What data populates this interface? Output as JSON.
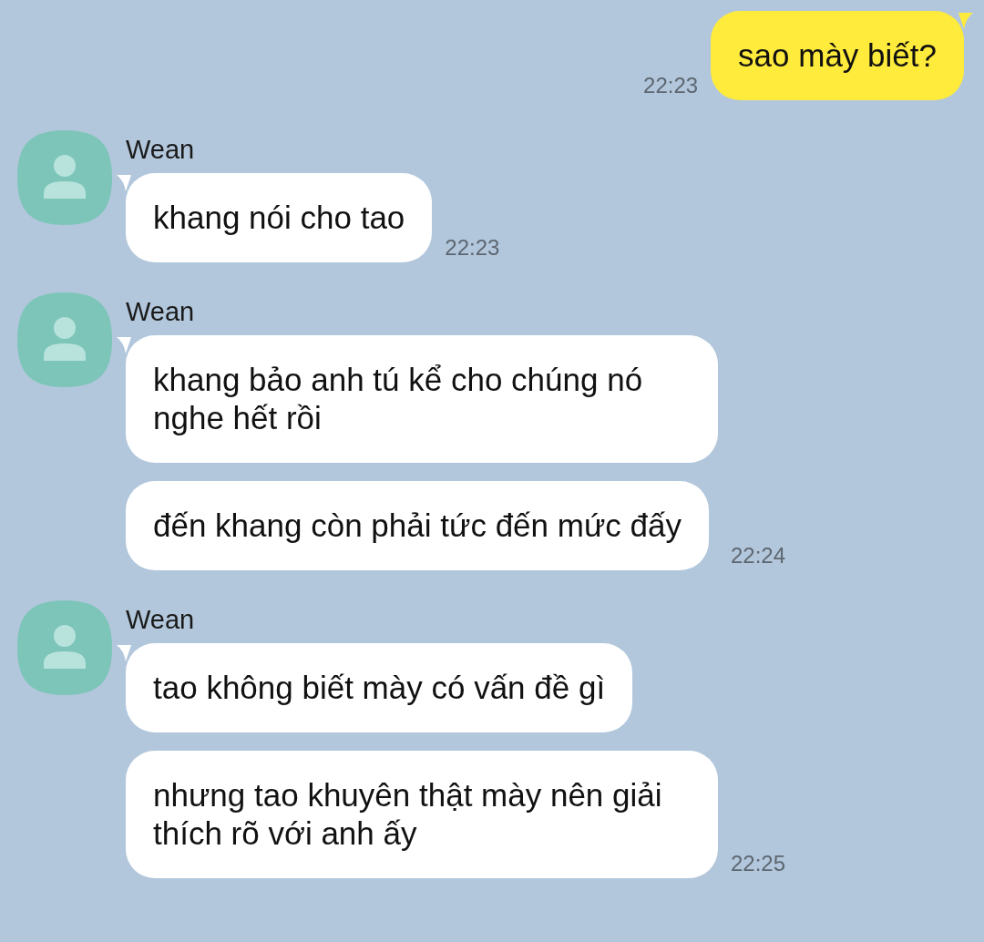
{
  "messages": [
    {
      "kind": "outgoing",
      "texts": [
        "sao mày biết?"
      ],
      "time": "22:23"
    },
    {
      "kind": "incoming",
      "sender": "Wean",
      "texts": [
        "khang nói cho tao"
      ],
      "time": "22:23"
    },
    {
      "kind": "incoming",
      "sender": "Wean",
      "texts": [
        "khang bảo anh tú kể cho chúng nó nghe hết rồi",
        "đến khang còn phải tức đến mức đấy"
      ],
      "time": "22:24"
    },
    {
      "kind": "incoming",
      "sender": "Wean",
      "texts": [
        "tao không biết mày có vấn đề gì",
        "nhưng tao khuyên thật mày nên giải thích rõ với anh ấy"
      ],
      "time": "22:25"
    }
  ]
}
